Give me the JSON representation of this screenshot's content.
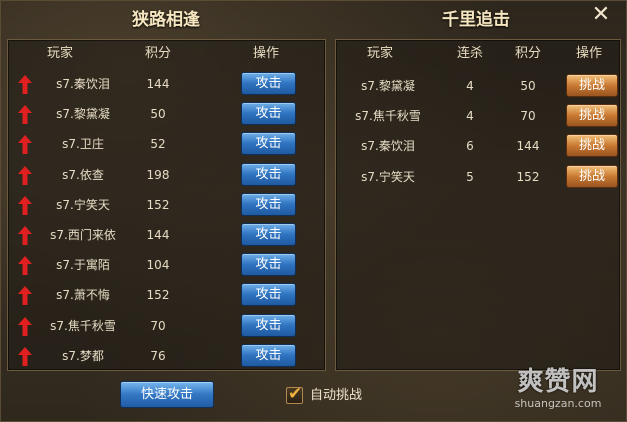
{
  "left": {
    "title": "狭路相逢",
    "headers": {
      "player": "玩家",
      "score": "积分",
      "action": "操作"
    },
    "rows": [
      {
        "player": "s7.秦饮泪",
        "score": "144",
        "button": "攻击"
      },
      {
        "player": "s7.黎黛凝",
        "score": "50",
        "button": "攻击"
      },
      {
        "player": "s7.卫庄",
        "score": "52",
        "button": "攻击"
      },
      {
        "player": "s7.依查",
        "score": "198",
        "button": "攻击"
      },
      {
        "player": "s7.宁笑天",
        "score": "152",
        "button": "攻击"
      },
      {
        "player": "s7.西门来依",
        "score": "144",
        "button": "攻击"
      },
      {
        "player": "s7.于寓陌",
        "score": "104",
        "button": "攻击"
      },
      {
        "player": "s7.萧不悔",
        "score": "152",
        "button": "攻击"
      },
      {
        "player": "s7.焦千秋雪",
        "score": "70",
        "button": "攻击"
      },
      {
        "player": "s7.梦都",
        "score": "76",
        "button": "攻击"
      }
    ]
  },
  "right": {
    "title": "千里追击",
    "headers": {
      "player": "玩家",
      "streak": "连杀",
      "score": "积分",
      "action": "操作"
    },
    "rows": [
      {
        "player": "s7.黎黛凝",
        "streak": "4",
        "score": "50",
        "button": "挑战"
      },
      {
        "player": "s7.焦千秋雪",
        "streak": "4",
        "score": "70",
        "button": "挑战"
      },
      {
        "player": "s7.秦饮泪",
        "streak": "6",
        "score": "144",
        "button": "挑战"
      },
      {
        "player": "s7.宁笑天",
        "streak": "5",
        "score": "152",
        "button": "挑战"
      }
    ]
  },
  "footer": {
    "quick_attack": "快速攻击",
    "auto_challenge": "自动挑战",
    "auto_checked": true
  },
  "window": {
    "close": "✕"
  },
  "watermark": {
    "main": "爽赞网",
    "sub": "shuangzan.com"
  },
  "colors": {
    "attack_button": "#2f73c0",
    "challenge_button": "#c97a32",
    "up_arrow": "#e02020",
    "panel_border": "#6b5a3d"
  }
}
